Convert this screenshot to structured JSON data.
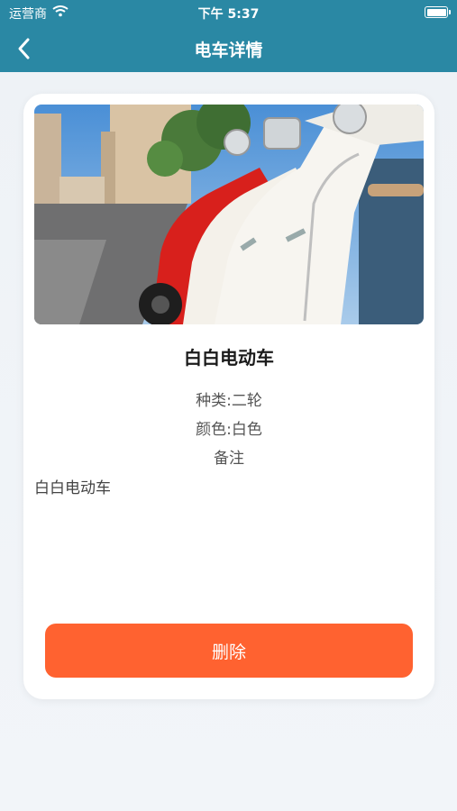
{
  "status_bar": {
    "carrier": "运营商",
    "time": "下午 5:37"
  },
  "nav": {
    "title": "电车详情",
    "back_icon": "chevron-left-icon"
  },
  "vehicle": {
    "name": "白白电动车",
    "type_text": "种类:二轮",
    "color_text": "颜色:白色",
    "note_label": "备注",
    "note_value": "白白电动车",
    "photo_desc_icon": "scooter-photo"
  },
  "actions": {
    "delete_label": "删除"
  },
  "colors": {
    "header": "#2a88a4",
    "delete_button": "#ff6230",
    "background": "#eef2f6"
  }
}
